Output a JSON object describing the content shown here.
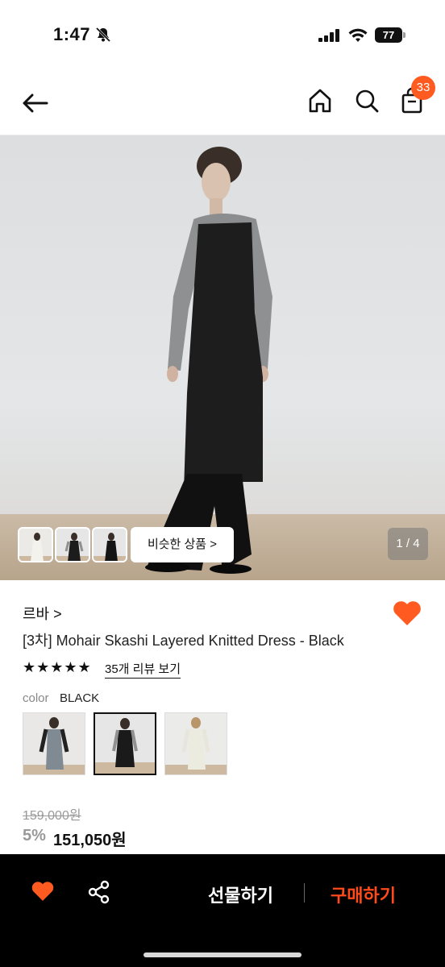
{
  "status_bar": {
    "time": "1:47",
    "battery": "77"
  },
  "header": {
    "cart_count": "33"
  },
  "gallery": {
    "similar_label": "비슷한 상품 >",
    "counter": "1 / 4"
  },
  "product": {
    "brand": "르바 >",
    "title": "[3차] Mohair Skashi Layered Knitted Dress - Black",
    "rating_stars": "★★★★★",
    "reviews_link": "35개 리뷰 보기",
    "color_label": "color",
    "color_value": "BLACK",
    "original_price": "159,000원",
    "discount": "5%",
    "price": "151,050원"
  },
  "bottom_bar": {
    "gift_label": "선물하기",
    "buy_label": "구매하기"
  },
  "colors": {
    "accent": "#ff5a1f",
    "buy": "#ff4a1c"
  }
}
